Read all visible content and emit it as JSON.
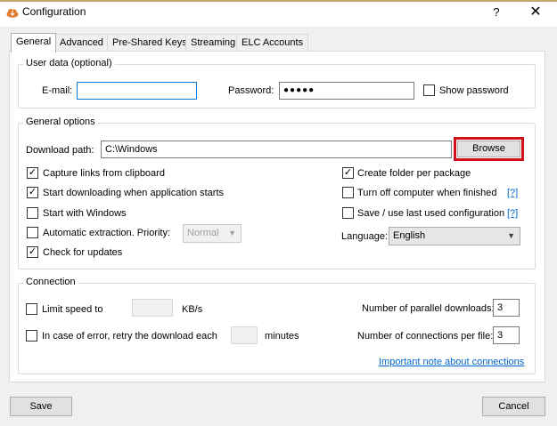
{
  "window": {
    "title": "Configuration",
    "help_label": "?",
    "close_label": "✕"
  },
  "tabs": [
    {
      "label": "General",
      "active": true
    },
    {
      "label": "Advanced"
    },
    {
      "label": "Pre-Shared Keys"
    },
    {
      "label": "Streaming"
    },
    {
      "label": "ELC Accounts"
    }
  ],
  "user_data": {
    "title": "User data (optional)",
    "email_label": "E-mail:",
    "email_value": "",
    "password_label": "Password:",
    "password_value": "●●●●●",
    "show_password_label": "Show password",
    "show_password_checked": false
  },
  "general_options": {
    "title": "General options",
    "download_path_label": "Download path:",
    "download_path_value": "C:\\Windows",
    "browse_label": "Browse",
    "capture_links_label": "Capture links from clipboard",
    "start_downloading_label": "Start downloading when application starts",
    "start_with_windows_label": "Start with Windows",
    "auto_extraction_label": "Automatic extraction. Priority:",
    "priority_value": "Normal",
    "check_updates_label": "Check for updates",
    "create_folder_label": "Create folder per package",
    "turn_off_label": "Turn off computer when finished",
    "turn_off_help": "[?]",
    "save_config_label": "Save / use last used configuration",
    "save_config_help": "[?]",
    "language_label": "Language:",
    "language_value": "English",
    "check_mark": "✓"
  },
  "connection": {
    "title": "Connection",
    "limit_speed_label": "Limit speed to",
    "speed_value": "",
    "speed_unit": "KB/s",
    "retry_label": "In case of error, retry the download each",
    "retry_value": "",
    "retry_unit": "minutes",
    "parallel_label": "Number of parallel downloads:",
    "parallel_value": "3",
    "connections_label": "Number of connections per file:",
    "connections_value": "3",
    "note_link": "Important note about connections"
  },
  "footer": {
    "save_label": "Save",
    "cancel_label": "Cancel"
  },
  "colors": {
    "highlight": "#d0101a",
    "focus": "#0078d7",
    "link": "#0066cc",
    "logo": "#e07a2e"
  }
}
